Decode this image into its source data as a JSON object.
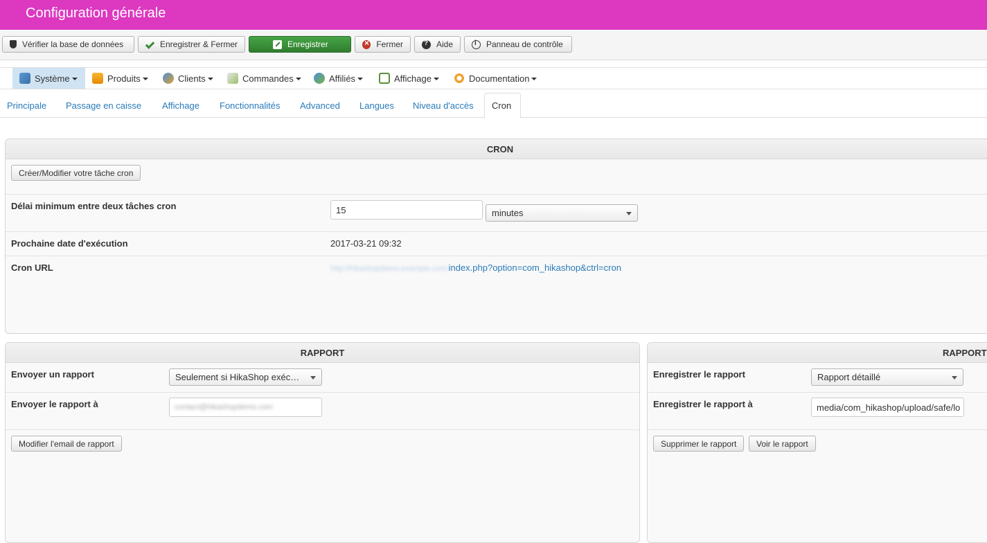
{
  "header": {
    "title": "Configuration générale"
  },
  "toolbar": {
    "check_db": "Vérifier la base de données",
    "save_close": "Enregistrer & Fermer",
    "save": "Enregistrer",
    "close": "Fermer",
    "help": "Aide",
    "control_panel": "Panneau de contrôle"
  },
  "menu": {
    "items": [
      {
        "label": "Système",
        "icon": "tools-icon"
      },
      {
        "label": "Produits",
        "icon": "box-icon"
      },
      {
        "label": "Clients",
        "icon": "users-icon"
      },
      {
        "label": "Commandes",
        "icon": "orders-icon"
      },
      {
        "label": "Affiliés",
        "icon": "affiliates-icon"
      },
      {
        "label": "Affichage",
        "icon": "display-icon"
      },
      {
        "label": "Documentation",
        "icon": "documentation-icon"
      }
    ]
  },
  "tabs": [
    "Principale",
    "Passage en caisse",
    "Affichage",
    "Fonctionnalités",
    "Advanced",
    "Langues",
    "Niveau d'accès",
    "Cron"
  ],
  "cron": {
    "title": "CRON",
    "create_button": "Créer/Modifier votre tâche cron",
    "min_delay_label": "Délai minimum entre deux tâches cron",
    "min_delay_value": "15",
    "min_delay_unit": "minutes",
    "next_date_label": "Prochaine date d'exécution",
    "next_date_value": "2017-03-21 09:32",
    "url_label": "Cron URL",
    "url_host": "http://hikashopdemo.example.com/",
    "url_path": "index.php?option=com_hikashop&ctrl=cron"
  },
  "report_left": {
    "title": "RAPPORT",
    "send_label": "Envoyer un rapport",
    "send_value": "Seulement si HikaShop exéc…",
    "send_to_label": "Envoyer le rapport à",
    "send_to_value": "contact@hikashopdemo.com",
    "edit_email_button": "Modifier l'email de rapport"
  },
  "report_right": {
    "title": "RAPPORT",
    "save_label": "Enregistrer le rapport",
    "save_value": "Rapport détaillé",
    "save_to_label": "Enregistrer le rapport à",
    "save_to_value": "media/com_hikashop/upload/safe/lo",
    "delete_button": "Supprimer le rapport",
    "view_button": "Voir le rapport"
  },
  "colors": {
    "header": "#dd38c0",
    "link": "#2a7ab8",
    "save_button": "#3a943a",
    "active_menu": "#cfe3f3"
  }
}
